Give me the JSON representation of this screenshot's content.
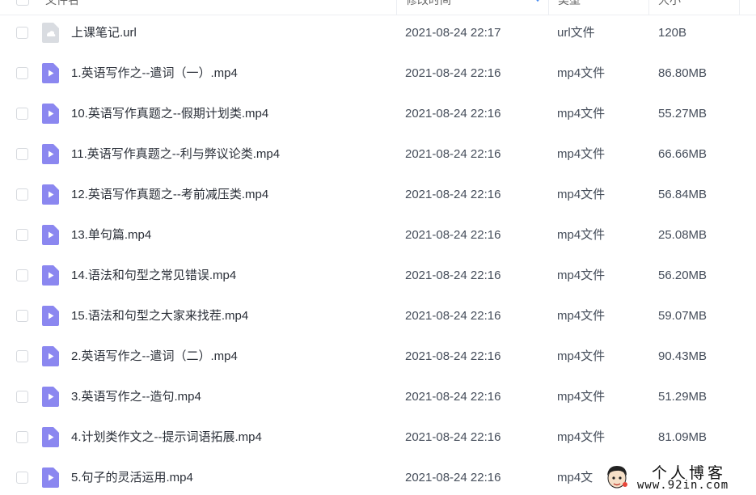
{
  "header": {
    "col_name": "文件名",
    "col_modified": "修改时间",
    "col_type": "类型",
    "col_size": "大小"
  },
  "files": [
    {
      "name": "上课笔记.url",
      "modified": "2021-08-24 22:17",
      "type": "url文件",
      "size": "120B",
      "icon": "url-file-icon"
    },
    {
      "name": "1.英语写作之--遣词（一）.mp4",
      "modified": "2021-08-24 22:16",
      "type": "mp4文件",
      "size": "86.80MB",
      "icon": "video-file-icon"
    },
    {
      "name": "10.英语写作真题之--假期计划类.mp4",
      "modified": "2021-08-24 22:16",
      "type": "mp4文件",
      "size": "55.27MB",
      "icon": "video-file-icon"
    },
    {
      "name": "11.英语写作真题之--利与弊议论类.mp4",
      "modified": "2021-08-24 22:16",
      "type": "mp4文件",
      "size": "66.66MB",
      "icon": "video-file-icon"
    },
    {
      "name": "12.英语写作真题之--考前减压类.mp4",
      "modified": "2021-08-24 22:16",
      "type": "mp4文件",
      "size": "56.84MB",
      "icon": "video-file-icon"
    },
    {
      "name": "13.单句篇.mp4",
      "modified": "2021-08-24 22:16",
      "type": "mp4文件",
      "size": "25.08MB",
      "icon": "video-file-icon"
    },
    {
      "name": "14.语法和句型之常见错误.mp4",
      "modified": "2021-08-24 22:16",
      "type": "mp4文件",
      "size": "56.20MB",
      "icon": "video-file-icon"
    },
    {
      "name": "15.语法和句型之大家来找茬.mp4",
      "modified": "2021-08-24 22:16",
      "type": "mp4文件",
      "size": "59.07MB",
      "icon": "video-file-icon"
    },
    {
      "name": "2.英语写作之--遣词（二）.mp4",
      "modified": "2021-08-24 22:16",
      "type": "mp4文件",
      "size": "90.43MB",
      "icon": "video-file-icon"
    },
    {
      "name": "3.英语写作之--造句.mp4",
      "modified": "2021-08-24 22:16",
      "type": "mp4文件",
      "size": "51.29MB",
      "icon": "video-file-icon"
    },
    {
      "name": "4.计划类作文之--提示词语拓展.mp4",
      "modified": "2021-08-24 22:16",
      "type": "mp4文件",
      "size": "81.09MB",
      "icon": "video-file-icon"
    },
    {
      "name": "5.句子的灵活运用.mp4",
      "modified": "2021-08-24 22:16",
      "type": "mp4文",
      "size": "",
      "icon": "video-file-icon"
    }
  ],
  "watermark": {
    "title": "个人博客",
    "url": "www.92in.com"
  },
  "colors": {
    "video_icon": "#8b87f0",
    "url_icon": "#d9dce1",
    "text": "#454d5a",
    "checkbox_border": "#d6d9de",
    "sort_accent": "#4d8ff0"
  }
}
